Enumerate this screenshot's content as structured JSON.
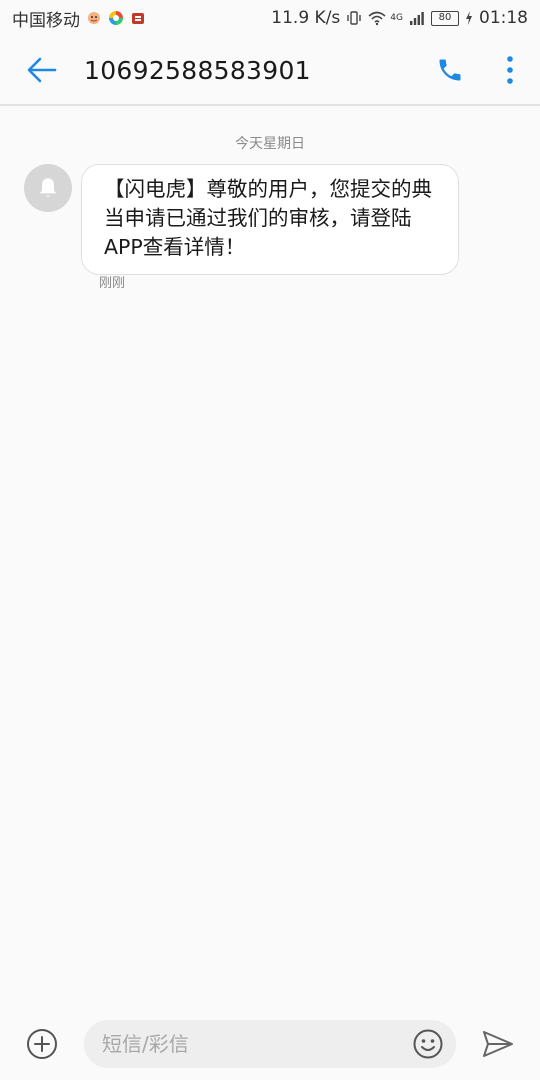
{
  "status_bar": {
    "carrier": "中国移动",
    "speed": "11.9 K/s",
    "network": "4G",
    "battery": "80",
    "time": "01:18"
  },
  "header": {
    "contact_number": "10692588583901"
  },
  "conversation": {
    "day_label": "今天星期日",
    "messages": [
      {
        "text": "【闪电虎】尊敬的用户，您提交的典当申请已通过我们的审核，请登陆APP查看详情！",
        "time": "刚刚"
      }
    ]
  },
  "composer": {
    "placeholder": "短信/彩信"
  },
  "colors": {
    "accent": "#1e88e5",
    "background": "#fafafa",
    "bubble": "#ffffff",
    "avatar": "#d6d6d6"
  }
}
